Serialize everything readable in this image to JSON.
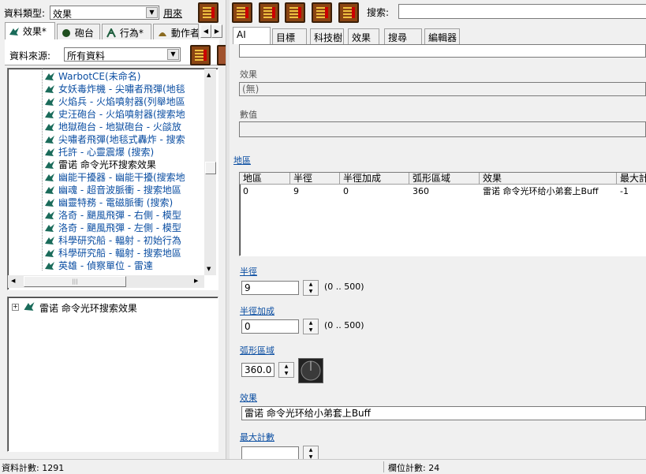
{
  "left": {
    "data_type_label": "資料類型:",
    "data_type_value": "效果",
    "use_label": "用來",
    "tabs": [
      {
        "label": "效果*"
      },
      {
        "label": "砲台"
      },
      {
        "label": "行為*"
      },
      {
        "label": "動作者"
      }
    ],
    "source_label": "資料來源:",
    "source_value": "所有資料",
    "tree_items": [
      {
        "text": "WarbotCE(未命名)"
      },
      {
        "text": "女妖毒炸機 - 尖嘯者飛彈(地毯"
      },
      {
        "text": "火焰兵 - 火焰噴射器(列舉地區"
      },
      {
        "text": "史汪砲台 - 火焰噴射器(搜索地"
      },
      {
        "text": "地獄砲台 - 地獄砲台 - 火燄放"
      },
      {
        "text": "尖嘯者飛彈(地毯式轟炸 - 搜索"
      },
      {
        "text": "托許 - 心靈震爆 (搜索)"
      },
      {
        "text": "雷诺 命令光环搜索效果",
        "selected": true
      },
      {
        "text": "幽能干擾器 - 幽能干擾(搜索地"
      },
      {
        "text": "幽魂 - 超音波脈衝 - 搜索地區"
      },
      {
        "text": "幽靈特務 - 電磁脈衝 (搜索)"
      },
      {
        "text": "洛奇 - 颶風飛彈 - 右側 - 模型"
      },
      {
        "text": "洛奇 - 颶風飛彈 - 左側 - 模型"
      },
      {
        "text": "科學研究船 - 輻射 - 初始行為"
      },
      {
        "text": "科學研究船 - 輻射 - 搜索地區"
      },
      {
        "text": "英雄 - 偵察單位 - 雷達"
      }
    ],
    "lower_tree_item": "雷诺 命令光环搜索效果"
  },
  "right": {
    "search_label": "搜索:",
    "search_value": "",
    "tabs": [
      {
        "label": "AI"
      },
      {
        "label": "目標"
      },
      {
        "label": "科技樹"
      },
      {
        "label": "效果"
      },
      {
        "label": "搜尋"
      },
      {
        "label": "編輯器"
      }
    ],
    "effect_label": "效果",
    "effect_value": "(無)",
    "value_label": "數值",
    "area_label": "地區",
    "grid_headers": [
      "地區",
      "半徑",
      "半徑加成",
      "弧形區域",
      "效果",
      "最大計"
    ],
    "grid_row": [
      "0",
      "9",
      "0",
      "360",
      "雷诺 命令光环给小弟套上Buff",
      "-1"
    ],
    "radius_label": "半徑",
    "radius_value": "9",
    "radius_range": "(0 .. 500)",
    "radius_bonus_label": "半徑加成",
    "radius_bonus_value": "0",
    "radius_bonus_range": "(0 .. 500)",
    "arc_label": "弧形區域",
    "arc_value": "360.0",
    "effect2_label": "效果",
    "effect2_value": "雷诺 命令光环给小弟套上Buff",
    "max_count_label": "最大計數"
  },
  "status": {
    "record_count": "資料計數: 1291",
    "field_count": "欄位計數: 24"
  }
}
